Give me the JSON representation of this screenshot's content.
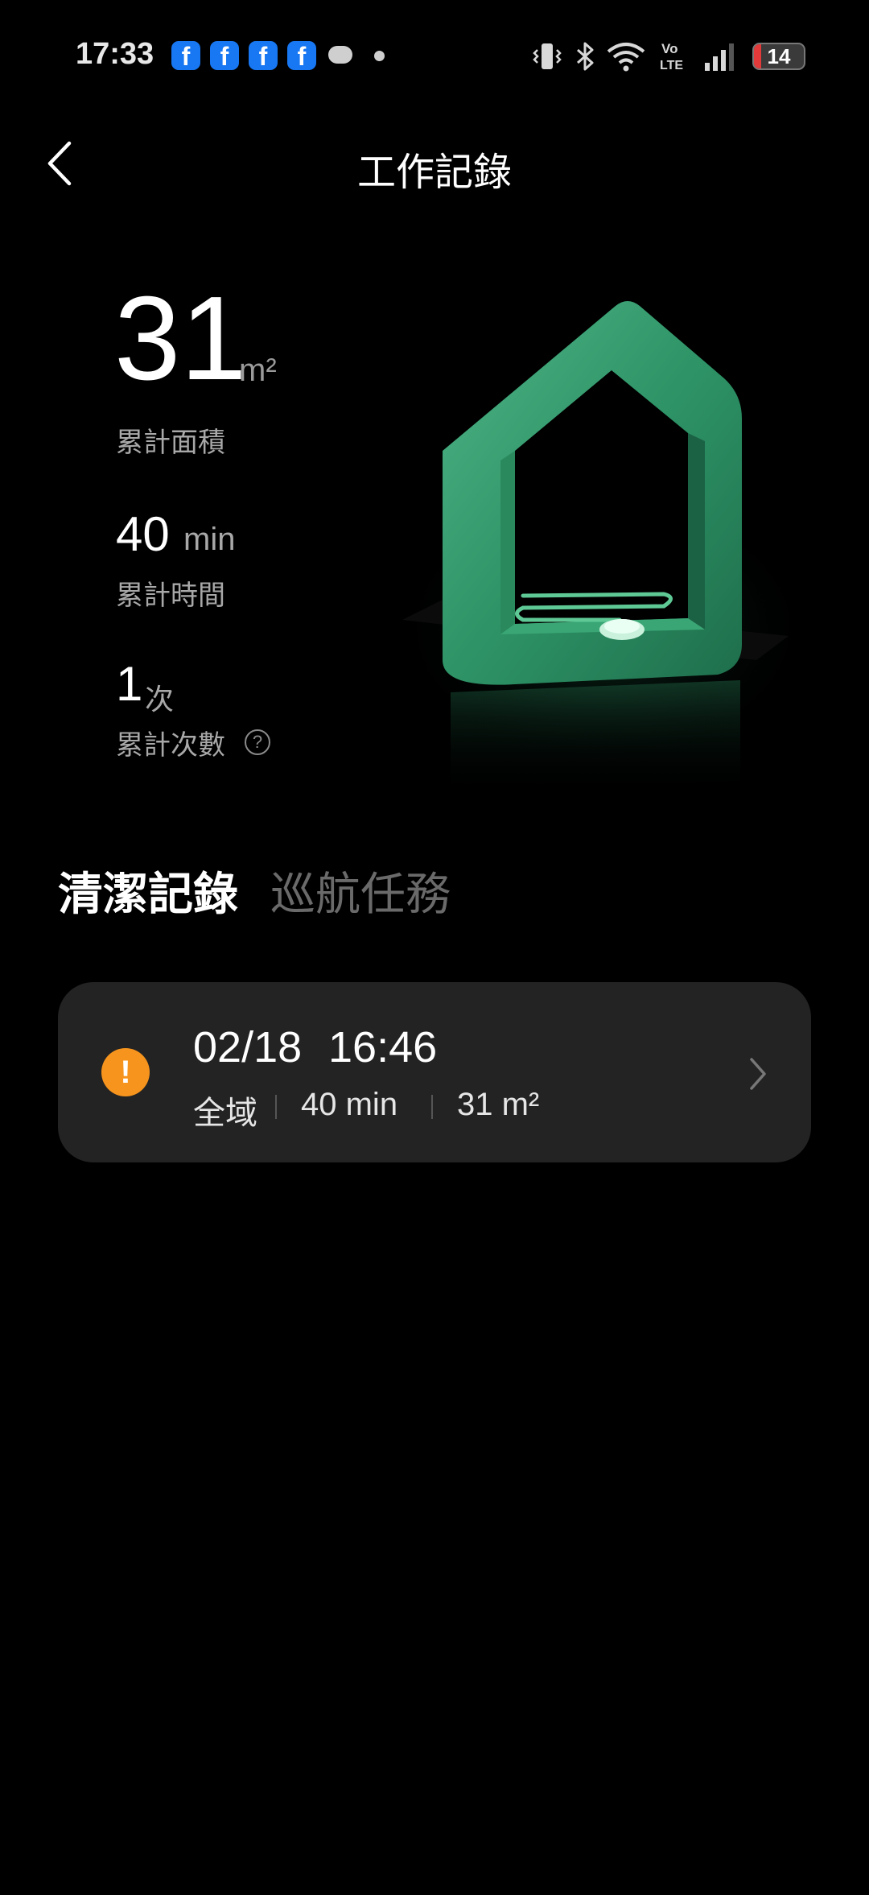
{
  "status_bar": {
    "time": "17:33",
    "notification_icons": [
      "facebook-icon",
      "facebook-icon",
      "facebook-icon",
      "facebook-icon",
      "chat-bubble-icon",
      "dot-icon"
    ],
    "system_icons": [
      "vibrate-icon",
      "bluetooth-icon",
      "wifi-icon",
      "volte-icon",
      "signal-icon"
    ],
    "battery_level": "14",
    "battery_fraction": 0.14,
    "volte_top": "Vo",
    "volte_bottom": "LTE",
    "fb_glyph": "f",
    "colors": {
      "facebook": "#1877f2",
      "battery_low": "#e23a3a"
    }
  },
  "header": {
    "title": "工作記錄"
  },
  "stats": {
    "area": {
      "value": "31",
      "unit": "m²",
      "label": "累計面積"
    },
    "time": {
      "value": "40",
      "unit": "min",
      "label": "累計時間"
    },
    "count": {
      "value": "1",
      "unit": "次",
      "label": "累計次數",
      "help_glyph": "?"
    }
  },
  "tabs": [
    {
      "label": "清潔記錄",
      "active": true
    },
    {
      "label": "巡航任務",
      "active": false
    }
  ],
  "records": [
    {
      "status_icon": "warning-icon",
      "status_glyph": "!",
      "date": "02/18",
      "time": "16:46",
      "scope": "全域",
      "duration": "40 min",
      "area": "31 m²",
      "colors": {
        "status": "#f7941d"
      }
    }
  ]
}
